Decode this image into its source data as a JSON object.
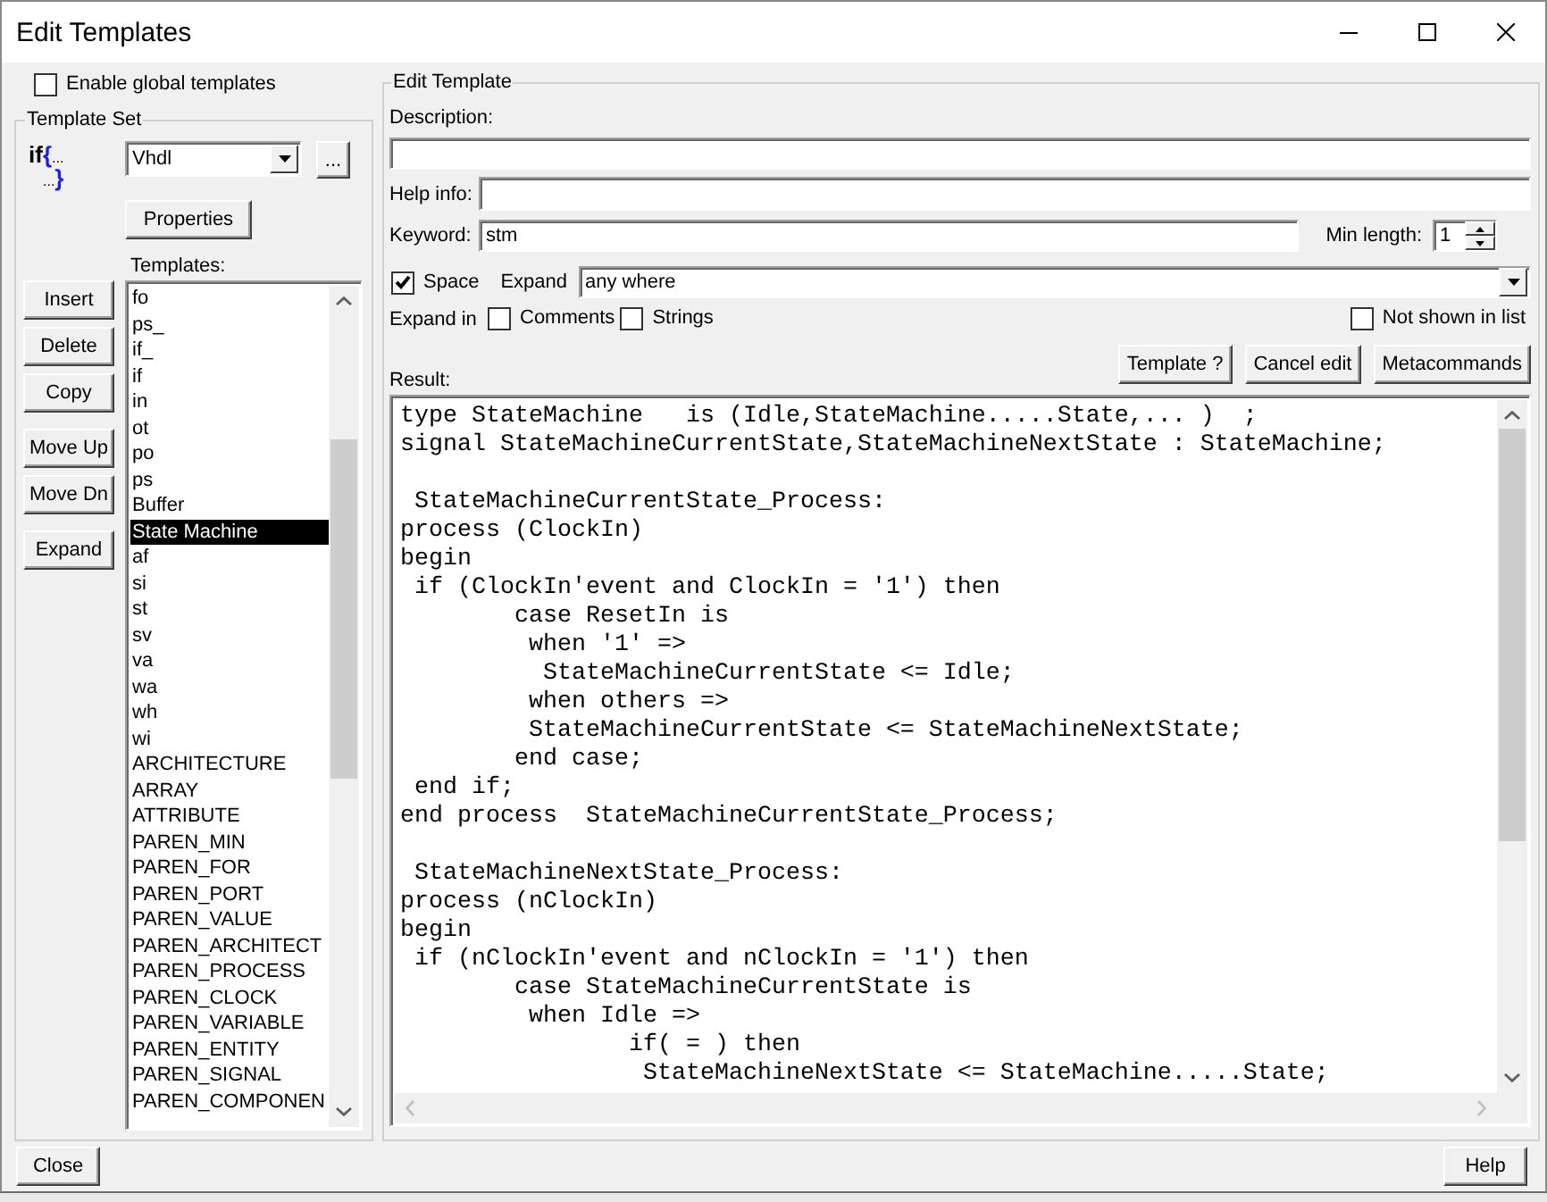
{
  "window": {
    "title": "Edit Templates"
  },
  "enable_global_templates": {
    "label": "Enable global templates",
    "checked": false
  },
  "template_set": {
    "title": "Template Set",
    "logo": {
      "keyword": "if",
      "open_brace": "{",
      "dots_1": "...",
      "dots_2": "...",
      "close_brace": "}"
    },
    "language": {
      "value": "Vhdl"
    },
    "browse_button": "...",
    "properties_button": "Properties",
    "templates_label": "Templates:",
    "actions": [
      [
        "Insert",
        "Delete",
        "Copy"
      ],
      [
        "Move Up",
        "Move Dn"
      ],
      [
        "Expand"
      ]
    ],
    "templates": [
      {
        "label": "fo",
        "selected": false
      },
      {
        "label": "ps_",
        "selected": false
      },
      {
        "label": "if_",
        "selected": false
      },
      {
        "label": "if",
        "selected": false
      },
      {
        "label": "in",
        "selected": false
      },
      {
        "label": "ot",
        "selected": false
      },
      {
        "label": "po",
        "selected": false
      },
      {
        "label": "ps",
        "selected": false
      },
      {
        "label": "Buffer",
        "selected": false
      },
      {
        "label": "State Machine",
        "selected": true
      },
      {
        "label": "af",
        "selected": false
      },
      {
        "label": "si",
        "selected": false
      },
      {
        "label": "st",
        "selected": false
      },
      {
        "label": "sv",
        "selected": false
      },
      {
        "label": "va",
        "selected": false
      },
      {
        "label": "wa",
        "selected": false
      },
      {
        "label": "wh",
        "selected": false
      },
      {
        "label": "wi",
        "selected": false
      },
      {
        "label": "ARCHITECTURE",
        "selected": false
      },
      {
        "label": "ARRAY",
        "selected": false
      },
      {
        "label": "ATTRIBUTE",
        "selected": false
      },
      {
        "label": "PAREN_MIN",
        "selected": false
      },
      {
        "label": "PAREN_FOR",
        "selected": false
      },
      {
        "label": "PAREN_PORT",
        "selected": false
      },
      {
        "label": "PAREN_VALUE",
        "selected": false
      },
      {
        "label": "PAREN_ARCHITECT",
        "selected": false
      },
      {
        "label": "PAREN_PROCESS",
        "selected": false
      },
      {
        "label": "PAREN_CLOCK",
        "selected": false
      },
      {
        "label": "PAREN_VARIABLE",
        "selected": false
      },
      {
        "label": "PAREN_ENTITY",
        "selected": false
      },
      {
        "label": "PAREN_SIGNAL",
        "selected": false
      },
      {
        "label": "PAREN_COMPONEN",
        "selected": false
      }
    ]
  },
  "edit_template": {
    "title": "Edit Template",
    "description": {
      "label": "Description:"
    },
    "help_info": {
      "label": "Help info:"
    },
    "keyword": {
      "label": "Keyword:",
      "value": "stm"
    },
    "min_length": {
      "label": "Min length:",
      "value": "1"
    },
    "space": {
      "label": "Space",
      "checked": true
    },
    "expand": {
      "label": "Expand",
      "value": "any where"
    },
    "expand_in": {
      "label": "Expand in",
      "options": [
        {
          "label": "Comments",
          "checked": false
        },
        {
          "label": "Strings",
          "checked": false
        }
      ]
    },
    "not_shown_in_list": {
      "label": "Not shown in list",
      "checked": false
    },
    "buttons": [
      "Template ?",
      "Cancel edit",
      "Metacommands"
    ],
    "result": {
      "label": "Result:",
      "code": "type StateMachine   is (Idle,StateMachine.....State,... )  ;\nsignal StateMachineCurrentState,StateMachineNextState : StateMachine;\n\n StateMachineCurrentState_Process:\nprocess (ClockIn)\nbegin\n if (ClockIn'event and ClockIn = '1') then\n        case ResetIn is\n         when '1' =>\n          StateMachineCurrentState <= Idle;\n         when others =>\n         StateMachineCurrentState <= StateMachineNextState;\n        end case;\n end if;\nend process  StateMachineCurrentState_Process;\n\n StateMachineNextState_Process:\nprocess (nClockIn)\nbegin\n if (nClockIn'event and nClockIn = '1') then\n        case StateMachineCurrentState is\n         when Idle =>\n                if( = ) then\n                 StateMachineNextState <= StateMachine.....State;"
    }
  },
  "close_button": "Close",
  "help_button": "Help"
}
